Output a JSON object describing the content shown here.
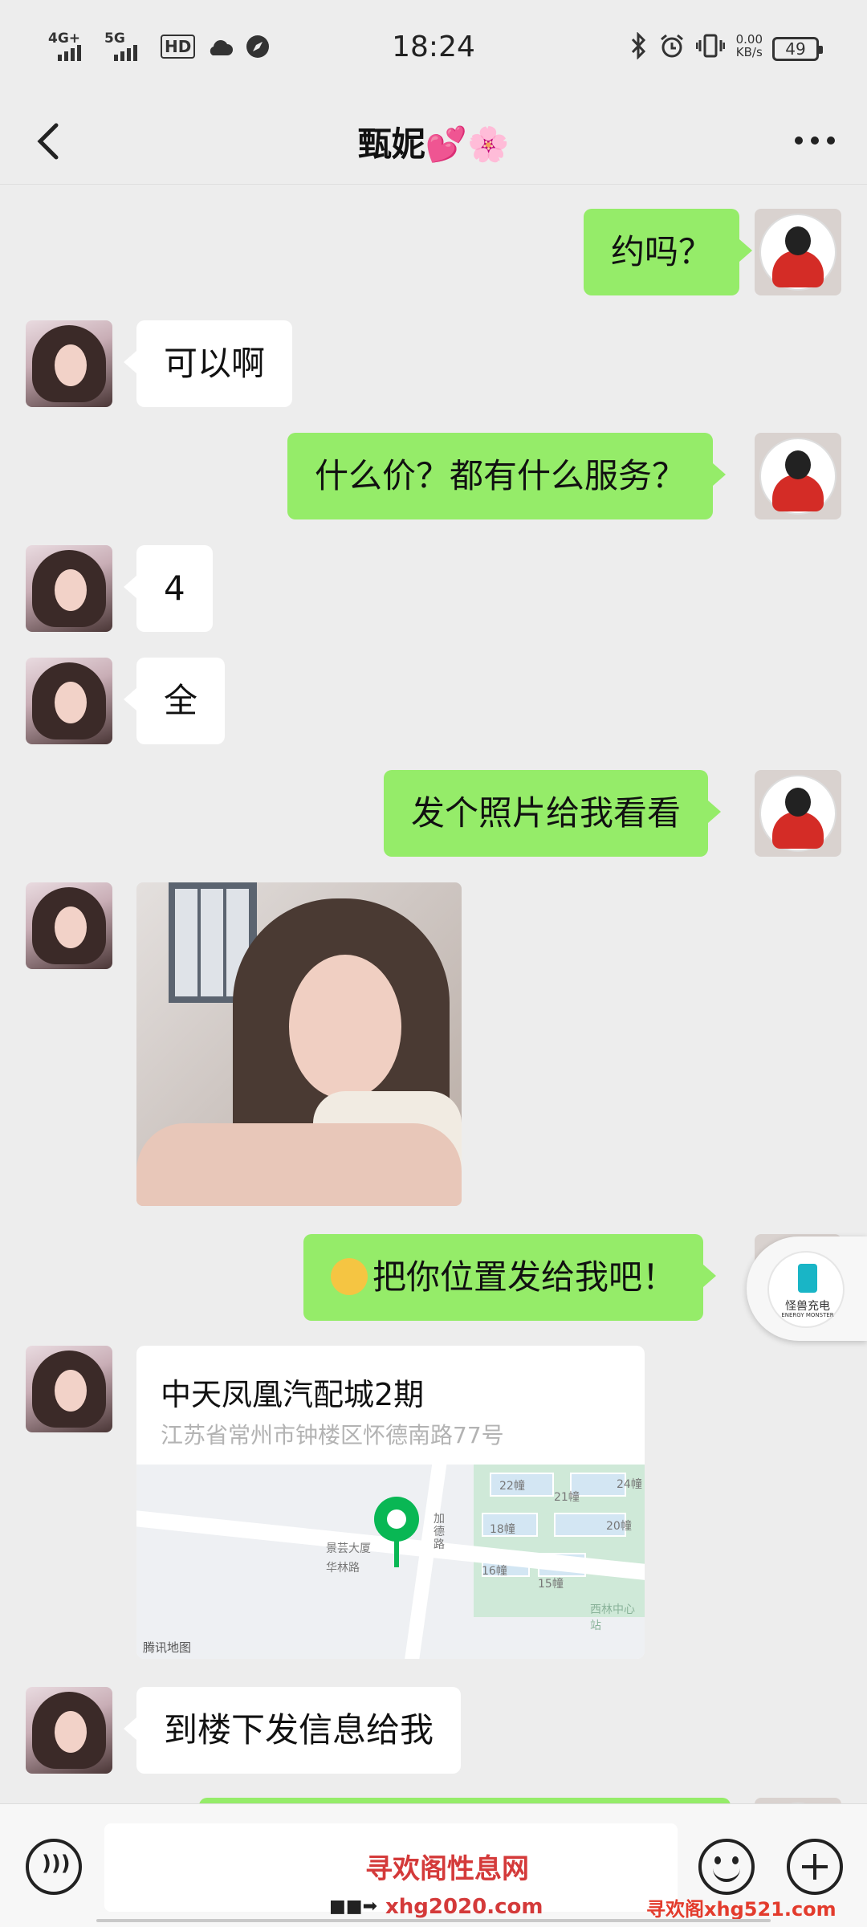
{
  "status_bar": {
    "signal1": "4G+",
    "signal2": "5G",
    "hd": "HD",
    "time": "18:24",
    "net_speed_value": "0.00",
    "net_speed_unit": "KB/s",
    "battery": "49"
  },
  "header": {
    "title": "甄妮💕🌸"
  },
  "messages": [
    {
      "from": "me",
      "text": "约吗？"
    },
    {
      "from": "her",
      "text": "可以啊"
    },
    {
      "from": "me",
      "text": "什么价？都有什么服务？"
    },
    {
      "from": "her",
      "text": "4"
    },
    {
      "from": "her",
      "text": "全"
    },
    {
      "from": "me",
      "text": "发个照片给我看看"
    },
    {
      "from": "her",
      "type": "image"
    },
    {
      "from": "me",
      "text": "把你位置发给我吧！"
    },
    {
      "from": "her",
      "type": "location"
    },
    {
      "from": "her",
      "text": "到楼下发信息给我"
    }
  ],
  "location": {
    "name": "中天凤凰汽配城2期",
    "address": "江苏省常州市钟楼区怀德南路77号",
    "map_source": "腾讯地图",
    "map_labels": [
      "景芸大厦",
      "华林路",
      "加德路",
      "22幢",
      "21幢",
      "18幢",
      "16幢",
      "15幢",
      "20幢",
      "24幢",
      "西林中心站"
    ]
  },
  "widget": {
    "title": "怪兽充电",
    "subtitle": "ENERGY MONSTER"
  },
  "watermarks": {
    "line1": "寻欢阁性息网",
    "line2": "xhg2020.com",
    "line3": "寻欢阁xhg521.com"
  },
  "colors": {
    "bubble_me": "#95ec69",
    "bubble_her": "#ffffff",
    "background": "#ededed",
    "map_pin": "#09b754"
  }
}
